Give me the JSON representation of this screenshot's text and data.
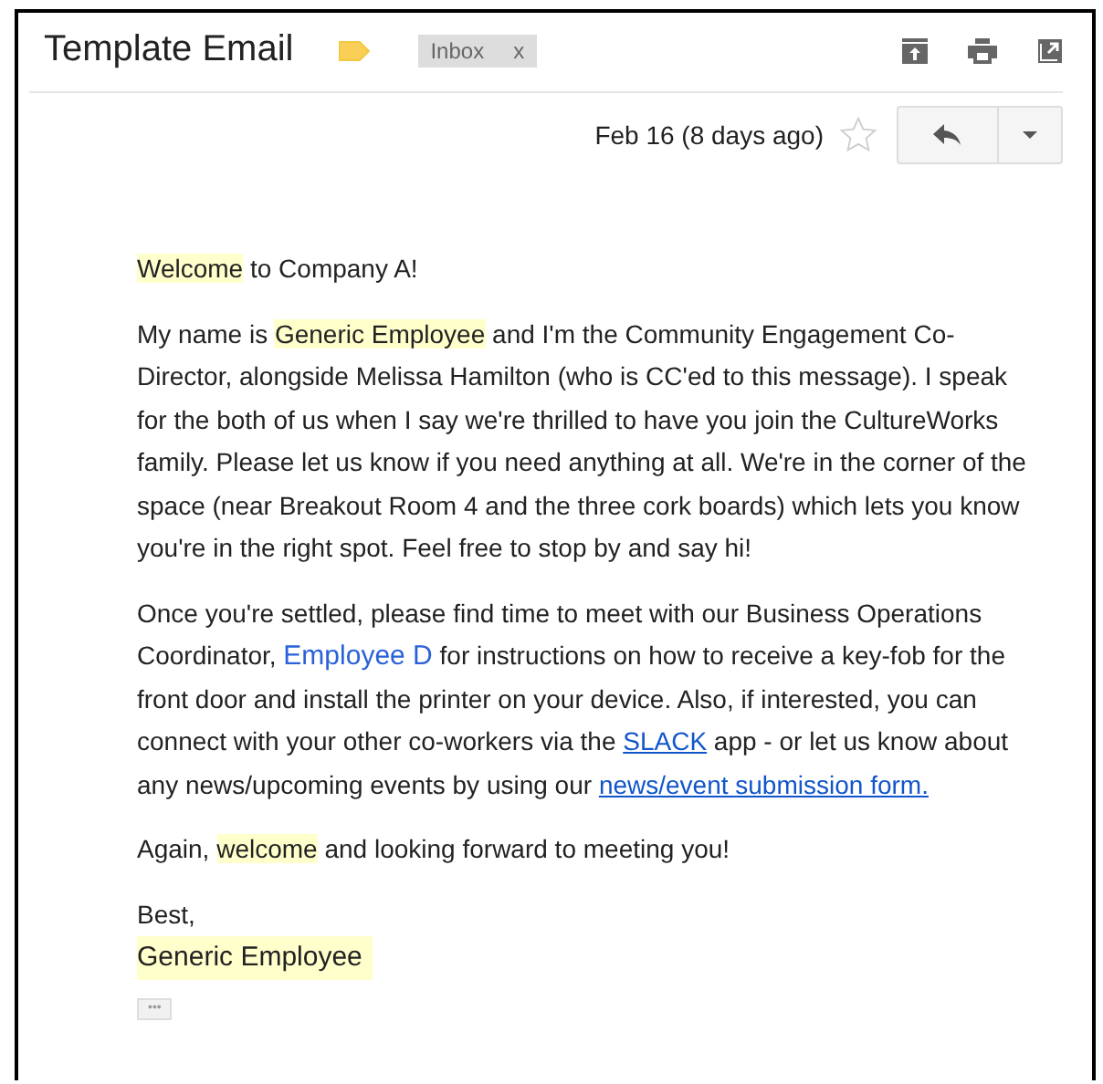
{
  "subject": "Template Email",
  "label": {
    "text": "Inbox",
    "remove": "x"
  },
  "date": "Feb 16 (8 days ago)",
  "starred": false,
  "paragraphs": [
    [
      {
        "kind": "highlight",
        "text": "Welcome"
      },
      {
        "kind": "text",
        "text": " to Company A!"
      }
    ],
    [
      {
        "kind": "text",
        "text": "My name is "
      },
      {
        "kind": "highlight",
        "text": "Generic Employee"
      },
      {
        "kind": "text",
        "text": " and I'm the Community Engagement Co-Director, alongside Melissa Hamilton (who is CC'ed to this message). I speak for the both of us when I say we're thrilled to have you join the CultureWorks family. Please let us know if you need anything at all. We're in the corner of the space (near Breakout Room 4 and the three cork boards) which lets you know you're in the right spot. Feel free to stop by and say hi!"
      }
    ],
    [
      {
        "kind": "text",
        "text": "Once you're settled, please find time to meet with our Business Operations Coordinator, "
      },
      {
        "kind": "mention",
        "text": "Employee D"
      },
      {
        "kind": "text",
        "text": "  for instructions on how to receive a key-fob for the front door and install the printer on your device. Also, if interested, you can connect with your other co-workers via the "
      },
      {
        "kind": "link",
        "text": "SLACK"
      },
      {
        "kind": "text",
        "text": " app  - or let us know about any news/upcoming events by using our "
      },
      {
        "kind": "link",
        "text": "news/event submission form."
      }
    ],
    [
      {
        "kind": "text",
        "text": "Again, "
      },
      {
        "kind": "highlight",
        "text": "welcome"
      },
      {
        "kind": "text",
        "text": " and looking forward to meeting you!"
      }
    ]
  ],
  "signoff": "Best,",
  "signature": "Generic Employee",
  "more": "•••"
}
